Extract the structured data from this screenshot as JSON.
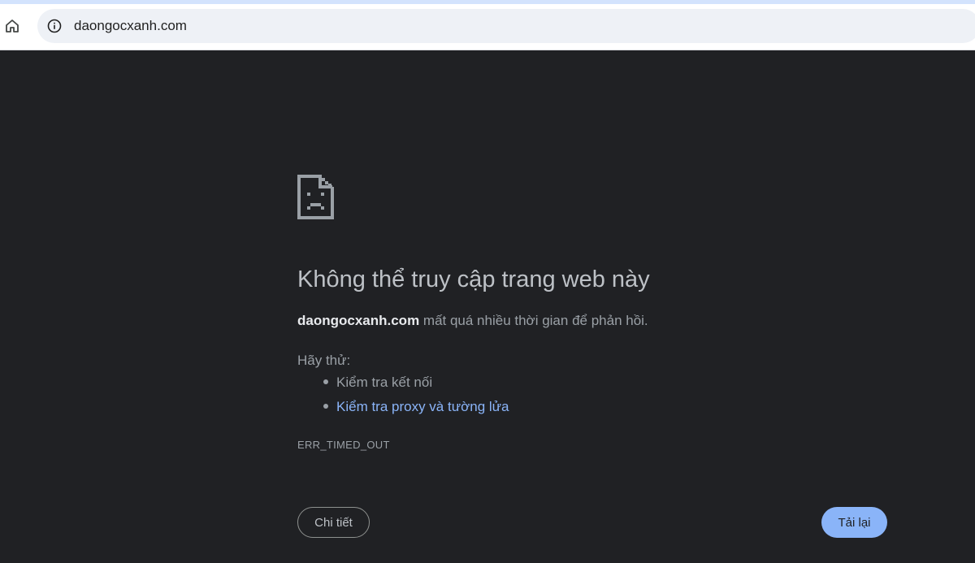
{
  "browser": {
    "url": "daongocxanh.com",
    "home_icon": "home-icon",
    "info_icon": "info-icon"
  },
  "error": {
    "icon": "sad-page-icon",
    "title": "Không thể truy cập trang web này",
    "domain": "daongocxanh.com",
    "message": " mất quá nhiều thời gian để phản hồi.",
    "try_label": "Hãy thử:",
    "suggestions": [
      {
        "text": "Kiểm tra kết nối",
        "link": false
      },
      {
        "text": "Kiểm tra proxy và tường lửa",
        "link": true
      }
    ],
    "code": "ERR_TIMED_OUT"
  },
  "buttons": {
    "details": "Chi tiết",
    "reload": "Tải lại"
  },
  "colors": {
    "background": "#202124",
    "link": "#8ab4f8",
    "reload_button": "#8ab4f8"
  }
}
